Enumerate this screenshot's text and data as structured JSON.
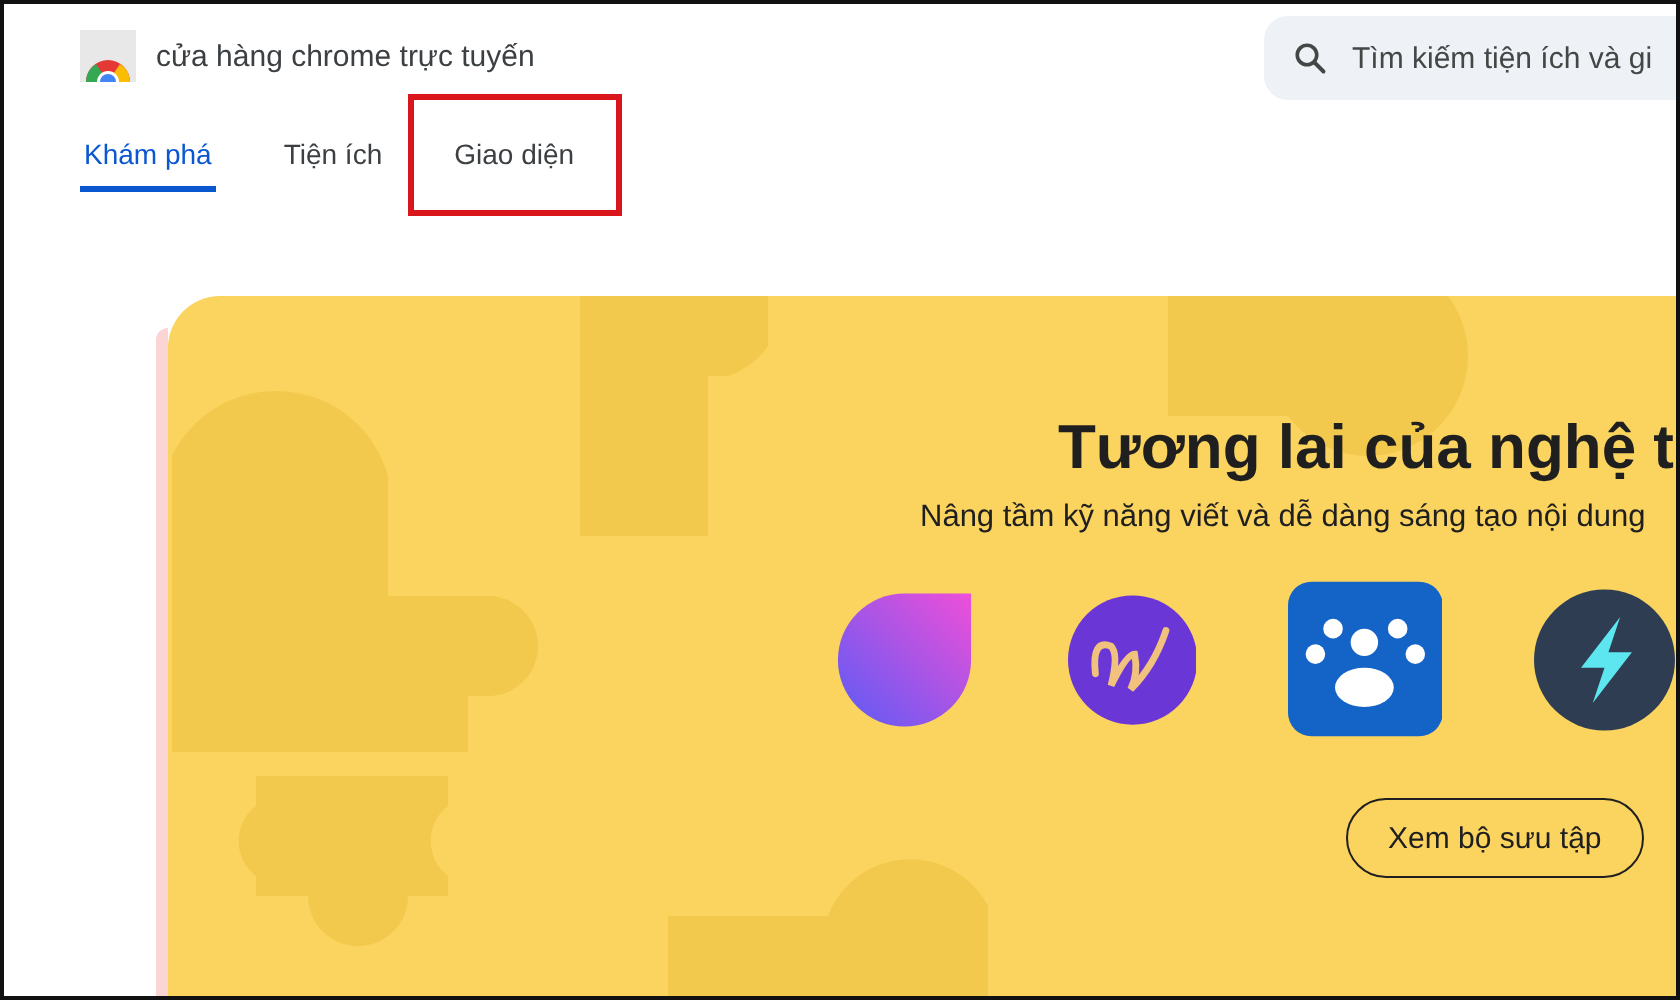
{
  "header": {
    "title": "cửa hàng chrome trực tuyến",
    "search": {
      "placeholder": "Tìm kiếm tiện ích và gi"
    }
  },
  "tabs": [
    {
      "label": "Khám phá",
      "selected": true,
      "highlighted": false
    },
    {
      "label": "Tiện ích",
      "selected": false,
      "highlighted": false
    },
    {
      "label": "Giao diện",
      "selected": false,
      "highlighted": true
    }
  ],
  "banner": {
    "title": "Tương lai của nghệ t",
    "subtitle": "Nâng tầm kỹ năng viết và dễ dàng sáng tạo nội dung",
    "button": "Xem bộ sưu tập"
  }
}
